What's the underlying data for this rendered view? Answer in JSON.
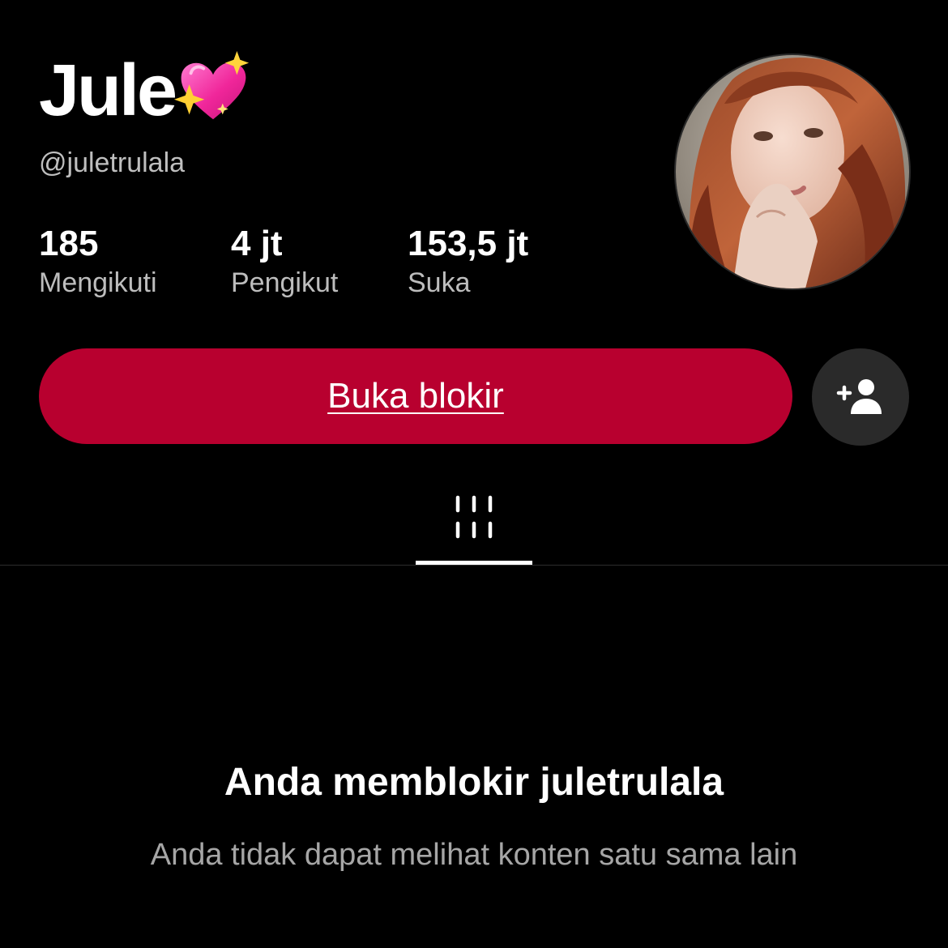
{
  "profile": {
    "display_name": "Jule",
    "name_emoji_icon": "sparkling-heart-icon",
    "handle": "@juletrulala",
    "avatar_icon": "profile-photo"
  },
  "stats": [
    {
      "value": "185",
      "label": "Mengikuti"
    },
    {
      "value": "4 jt",
      "label": "Pengikut"
    },
    {
      "value": "153,5 jt",
      "label": "Suka"
    }
  ],
  "actions": {
    "unblock_label": "Buka blokir",
    "add_friend_icon": "add-friend-icon"
  },
  "tabs": {
    "videos_icon": "grid-icon"
  },
  "blocked": {
    "title": "Anda memblokir juletrulala",
    "subtitle": "Anda tidak dapat melihat konten satu sama lain"
  },
  "colors": {
    "background": "#000000",
    "unblock_button": "#b8002f",
    "secondary_button": "#2a2a2a",
    "muted_text": "#a6a6a6"
  }
}
